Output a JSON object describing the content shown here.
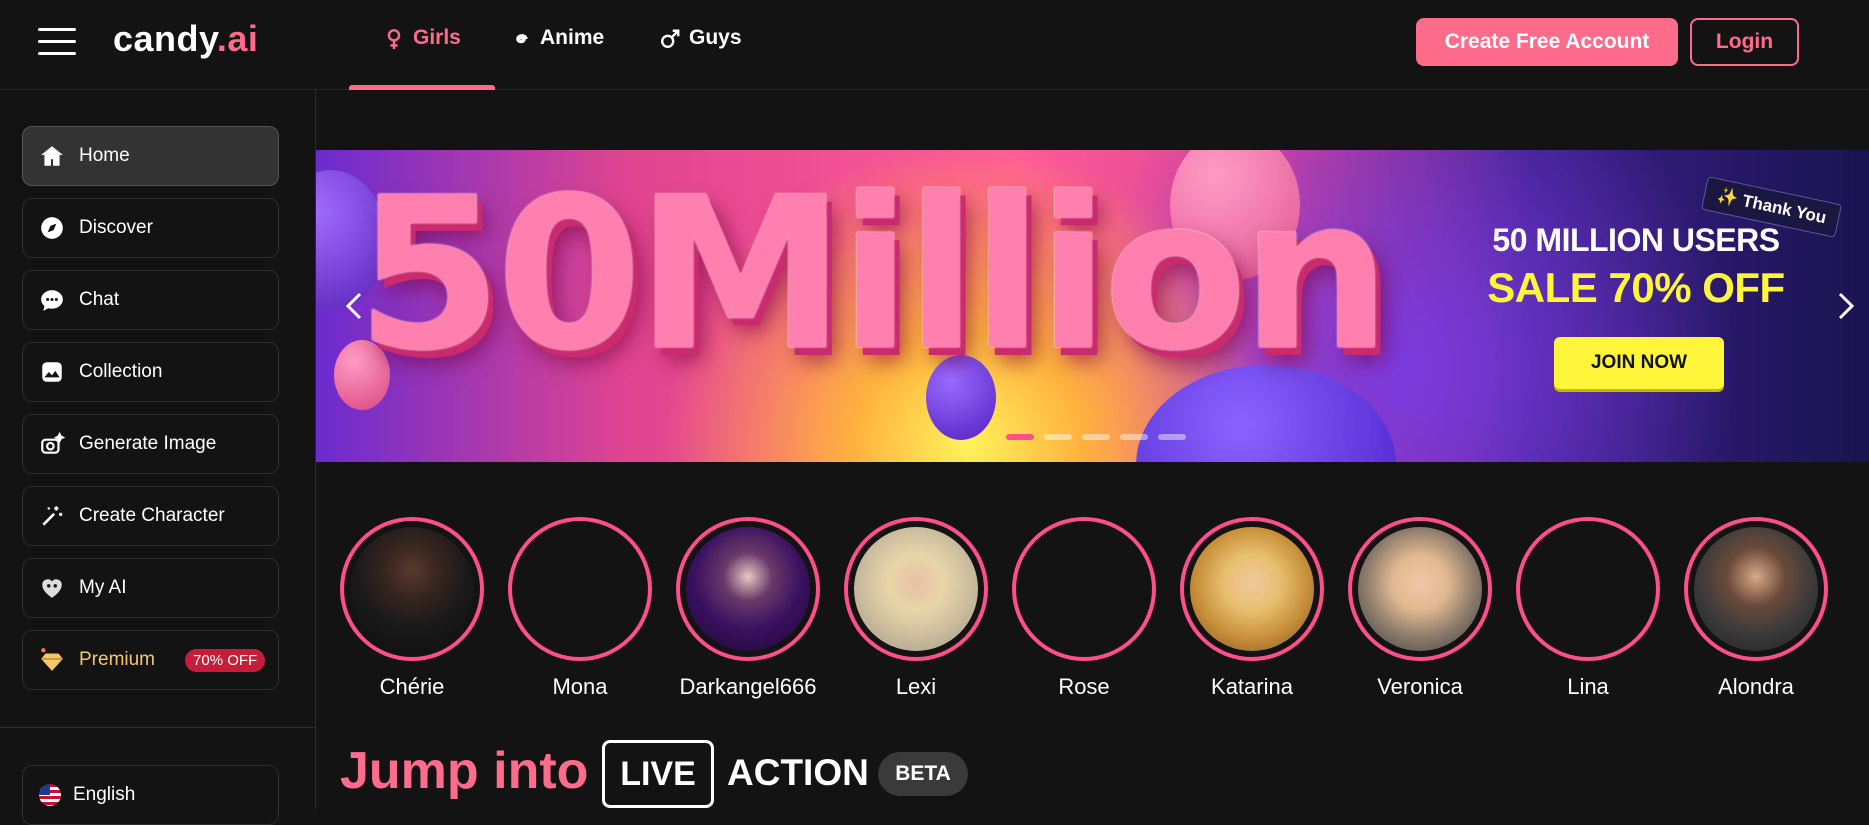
{
  "header": {
    "logo_text": "candy",
    "logo_suffix": ".ai",
    "tabs": [
      {
        "label": "Girls",
        "icon": "female-symbol-icon",
        "active": true
      },
      {
        "label": "Anime",
        "icon": "spiral-icon",
        "active": false
      },
      {
        "label": "Guys",
        "icon": "male-symbol-icon",
        "active": false
      }
    ],
    "create_account_label": "Create Free Account",
    "login_label": "Login"
  },
  "sidebar": {
    "items": [
      {
        "label": "Home",
        "icon": "home-icon",
        "active": true
      },
      {
        "label": "Discover",
        "icon": "compass-icon",
        "active": false
      },
      {
        "label": "Chat",
        "icon": "chat-bubble-icon",
        "active": false
      },
      {
        "label": "Collection",
        "icon": "image-gallery-icon",
        "active": false
      },
      {
        "label": "Generate Image",
        "icon": "camera-sparkle-icon",
        "active": false
      },
      {
        "label": "Create Character",
        "icon": "magic-wand-icon",
        "active": false
      },
      {
        "label": "My AI",
        "icon": "heart-mask-icon",
        "active": false
      },
      {
        "label": "Premium",
        "icon": "diamond-icon",
        "active": false,
        "badge": "70% OFF"
      }
    ],
    "language": "English"
  },
  "banner": {
    "headline": "50Million",
    "thank_you": "✨ Thank You",
    "promo_line1": "50 MILLION USERS",
    "promo_line2": "SALE 70% OFF",
    "cta_label": "JOIN NOW",
    "slide_count": 5,
    "active_slide": 0
  },
  "stories": [
    {
      "name": "Chérie",
      "has_image": true
    },
    {
      "name": "Mona",
      "has_image": false
    },
    {
      "name": "Darkangel666",
      "has_image": true
    },
    {
      "name": "Lexi",
      "has_image": true
    },
    {
      "name": "Rose",
      "has_image": false
    },
    {
      "name": "Katarina",
      "has_image": true
    },
    {
      "name": "Veronica",
      "has_image": true
    },
    {
      "name": "Lina",
      "has_image": false
    },
    {
      "name": "Alondra",
      "has_image": true
    }
  ],
  "live_section": {
    "jump_label": "Jump into",
    "live_label": "LIVE",
    "action_label": "ACTION",
    "beta_label": "BETA"
  },
  "colors": {
    "accent": "#ff6b8b",
    "background": "#131313",
    "promo_yellow": "#fff63c"
  }
}
